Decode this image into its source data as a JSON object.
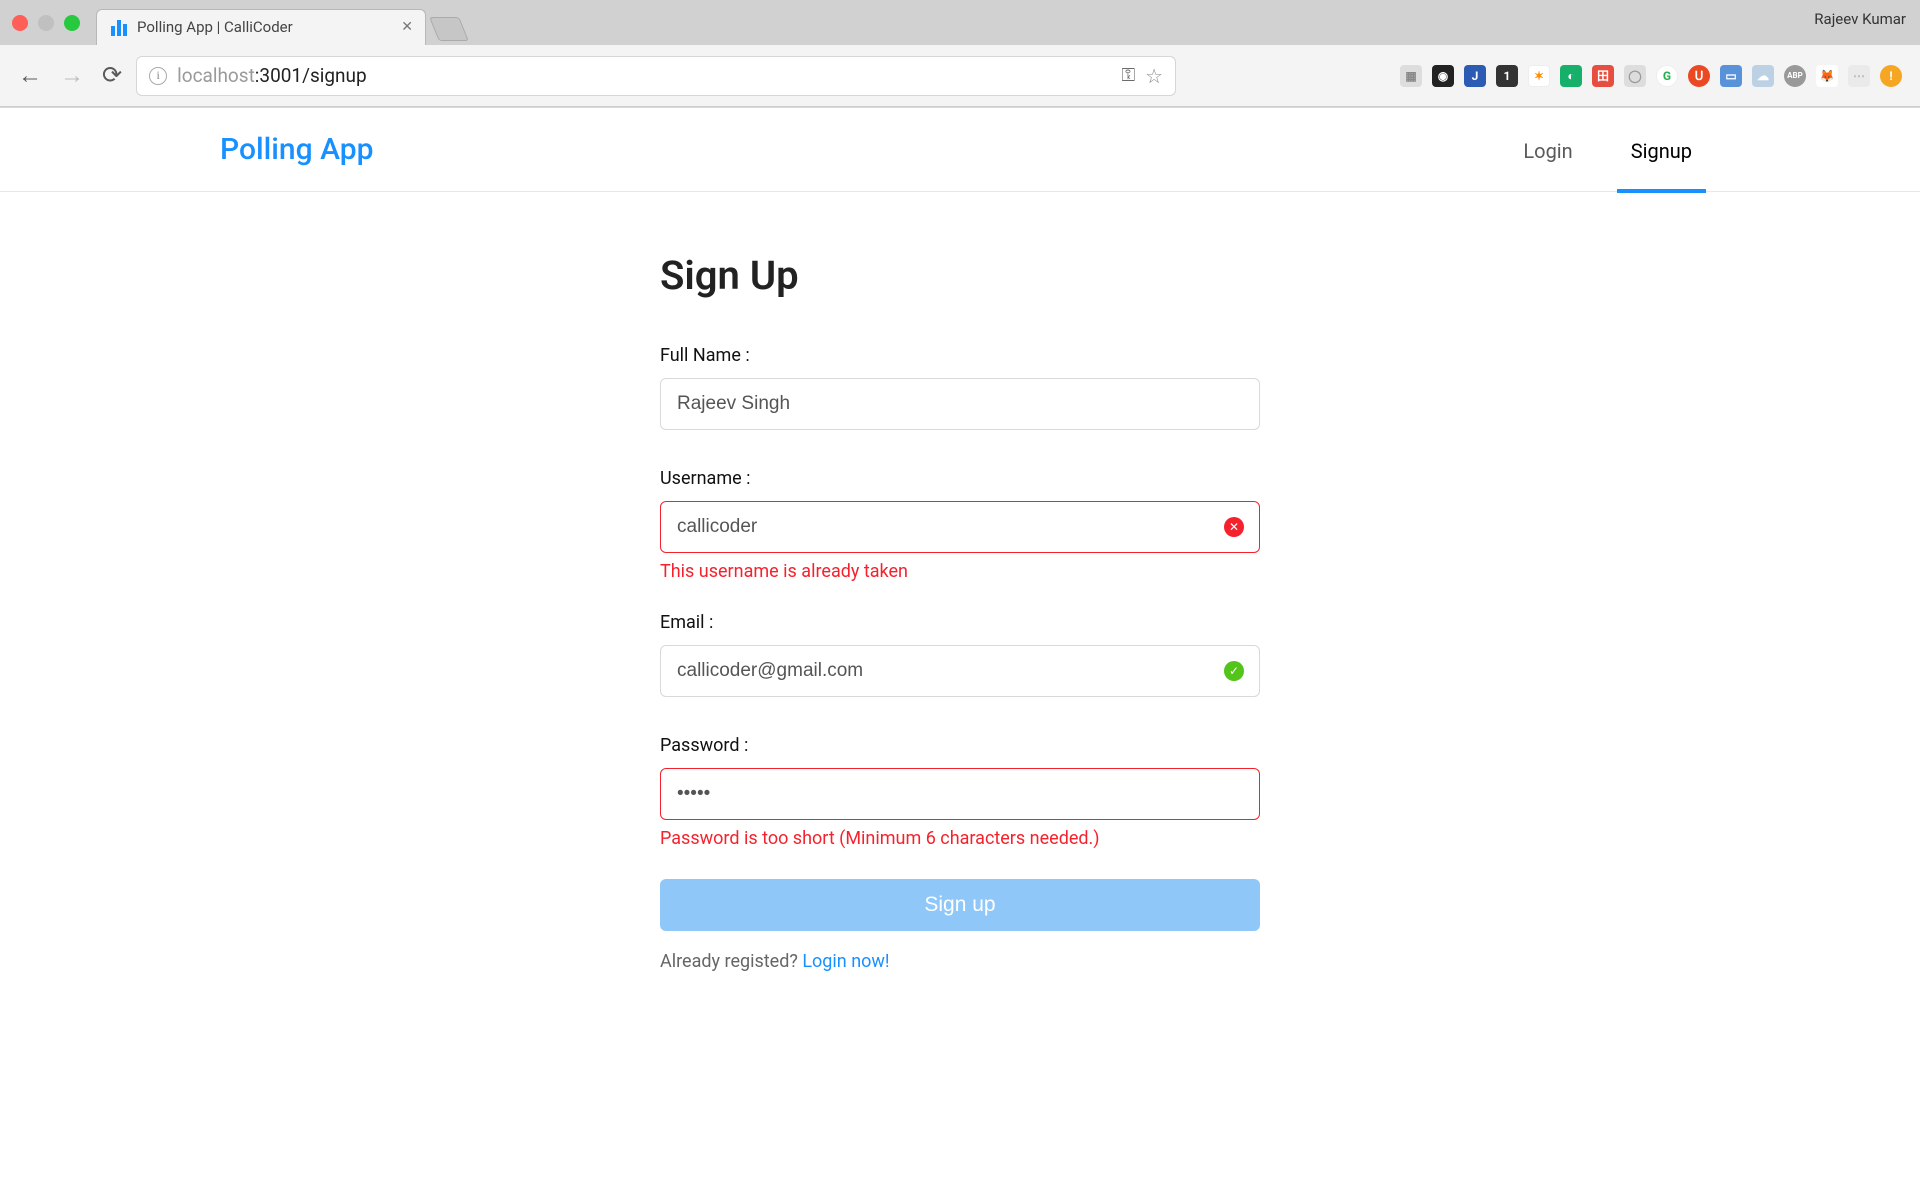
{
  "browser": {
    "tab_title": "Polling App | CalliCoder",
    "profile_name": "Rajeev Kumar",
    "url_host": "localhost",
    "url_port_path": ":3001/signup"
  },
  "header": {
    "brand": "Polling App",
    "nav_login": "Login",
    "nav_signup": "Signup"
  },
  "form": {
    "title": "Sign Up",
    "fullname_label": "Full Name :",
    "fullname_value": "Rajeev Singh",
    "username_label": "Username :",
    "username_value": "callicoder",
    "username_error": "This username is already taken",
    "email_label": "Email :",
    "email_value": "callicoder@gmail.com",
    "password_label": "Password :",
    "password_value": "•••••",
    "password_error": "Password is too short (Minimum 6 characters needed.)",
    "submit_label": "Sign up",
    "hint_prefix": "Already registed? ",
    "hint_link": "Login now!"
  }
}
